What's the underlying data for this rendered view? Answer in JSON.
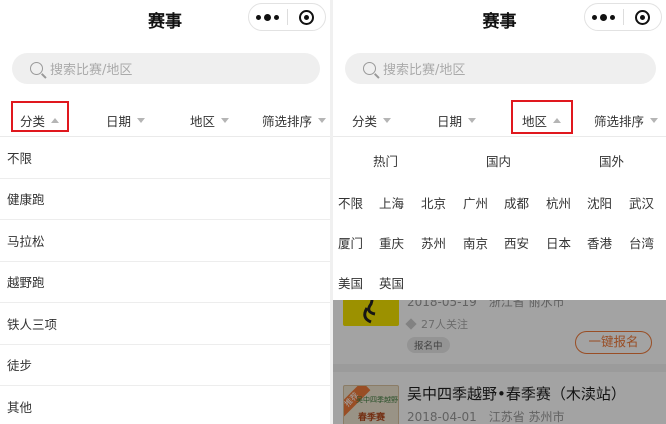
{
  "left": {
    "nav": {
      "title": "赛事"
    },
    "search": {
      "placeholder": "搜索比赛/地区"
    },
    "filters": {
      "category": "分类",
      "date": "日期",
      "region": "地区",
      "sort": "筛选排序"
    },
    "categories": [
      "不限",
      "健康跑",
      "马拉松",
      "越野跑",
      "铁人三项",
      "徒步",
      "其他"
    ]
  },
  "right": {
    "nav": {
      "title": "赛事"
    },
    "search": {
      "placeholder": "搜索比赛/地区"
    },
    "filters": {
      "category": "分类",
      "date": "日期",
      "region": "地区",
      "sort": "筛选排序"
    },
    "region_tabs": [
      "热门",
      "国内",
      "国外"
    ],
    "region_rows": [
      [
        "不限",
        "上海",
        "北京",
        "广州",
        "成都",
        "杭州",
        "沈阳",
        "武汉"
      ],
      [
        "厦门",
        "重庆",
        "苏州",
        "南京",
        "西安",
        "日本",
        "香港",
        "台湾"
      ],
      [
        "美国",
        "英国"
      ]
    ],
    "events": [
      {
        "date_location": "2018-05-19　浙江省 丽水市",
        "followers": "27人关注",
        "status": "报名中",
        "signup": "一键报名"
      },
      {
        "title": "吴中四季越野•春季赛（木渎站）",
        "date_location": "2018-04-01　江苏省 苏州市",
        "badge": "推荐",
        "thumb_top": "吴中四季越野赛",
        "thumb_bottom": "春季赛"
      }
    ]
  },
  "colors": {
    "highlight": "#e0181e",
    "accent": "#f07a3a",
    "search_bg": "#efefef"
  },
  "icons": [
    "more-dots-icon",
    "close-circle-icon",
    "search-icon",
    "caret-down-icon",
    "caret-up-icon",
    "heart-icon"
  ]
}
